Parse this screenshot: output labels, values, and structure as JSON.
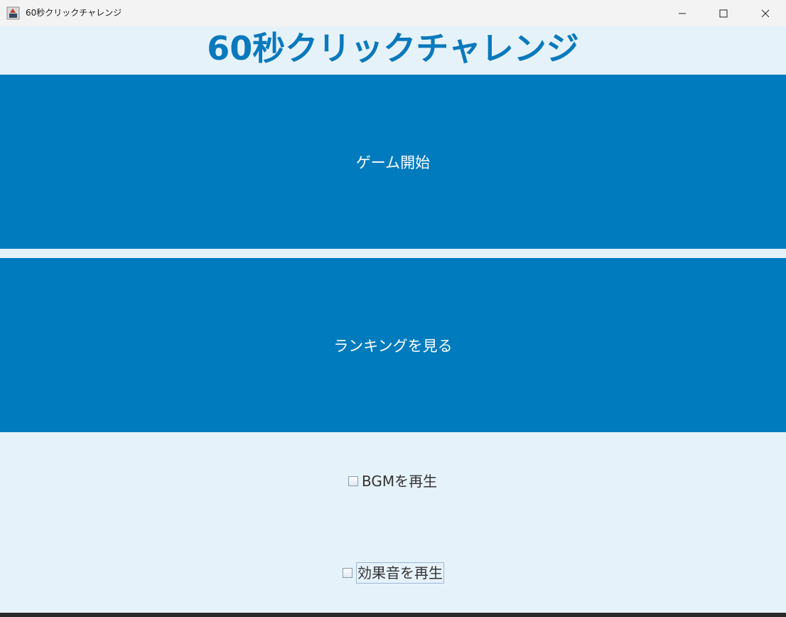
{
  "window": {
    "title": "60秒クリックチャレンジ"
  },
  "heading": "60秒クリックチャレンジ",
  "buttons": {
    "start": "ゲーム開始",
    "ranking": "ランキングを見る"
  },
  "options": {
    "bgm_label": "BGMを再生",
    "bgm_checked": false,
    "se_label": "効果音を再生",
    "se_checked": false
  },
  "colors": {
    "accent": "#007bbd",
    "heading": "#0a79bd",
    "background": "#e6f2fa"
  }
}
